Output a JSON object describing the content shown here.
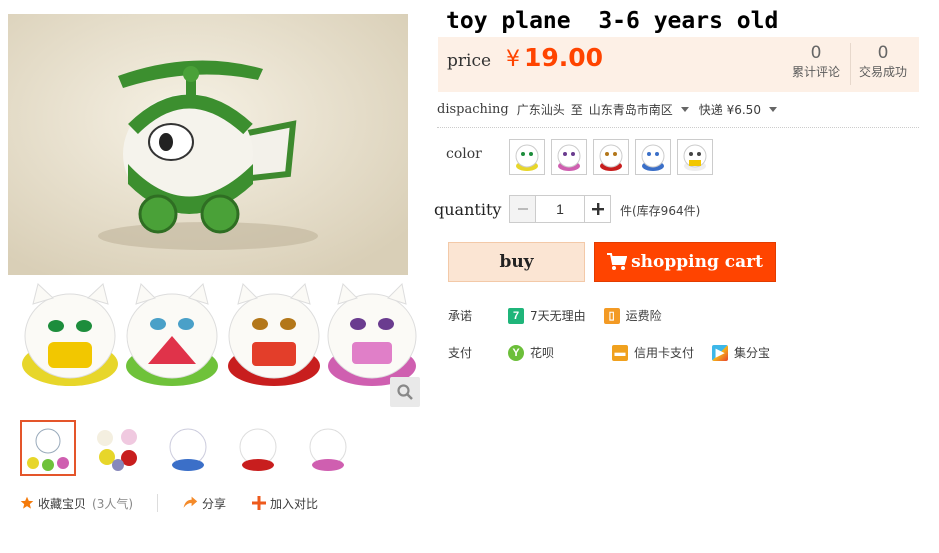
{
  "product": {
    "title": "toy plane  3-6 years old"
  },
  "price": {
    "label": "price",
    "currency": "¥",
    "value": "19.00",
    "stats": [
      {
        "count": "0",
        "label": "累计评论"
      },
      {
        "count": "0",
        "label": "交易成功"
      }
    ]
  },
  "dispatch": {
    "label": "dispaching",
    "from": "广东汕头",
    "to_word": "至",
    "to": "山东青岛市南区",
    "shipping": "快递 ¥6.50"
  },
  "color": {
    "label": "color",
    "options": [
      "yellow cat",
      "pink cat",
      "red cat",
      "blue cat",
      "white cat"
    ]
  },
  "quantity": {
    "label": "quantity",
    "value": "1",
    "stock": "件(库存964件)"
  },
  "buttons": {
    "buy": "buy",
    "cart": "shopping cart"
  },
  "services": {
    "promise_label": "承诺",
    "promise": [
      {
        "icon": "seven-day-icon",
        "text": "7天无理由"
      },
      {
        "icon": "shipping-insurance-icon",
        "text": "运费险"
      }
    ],
    "pay_label": "支付",
    "pay": [
      {
        "icon": "huabei-icon",
        "text": "花呗"
      },
      {
        "icon": "credit-card-icon",
        "text": "信用卡支付"
      },
      {
        "icon": "jifenbao-icon",
        "text": "集分宝"
      }
    ]
  },
  "gallery": {
    "thumbs": 5,
    "active_index": 0
  },
  "actions": {
    "favorite": "收藏宝贝",
    "favorite_count": "(3人气)",
    "share": "分享",
    "compare": "加入对比"
  },
  "colors": {
    "accent": "#ff4400",
    "price_bg": "#fdf0e6",
    "buy_bg": "#fbe5d3"
  }
}
